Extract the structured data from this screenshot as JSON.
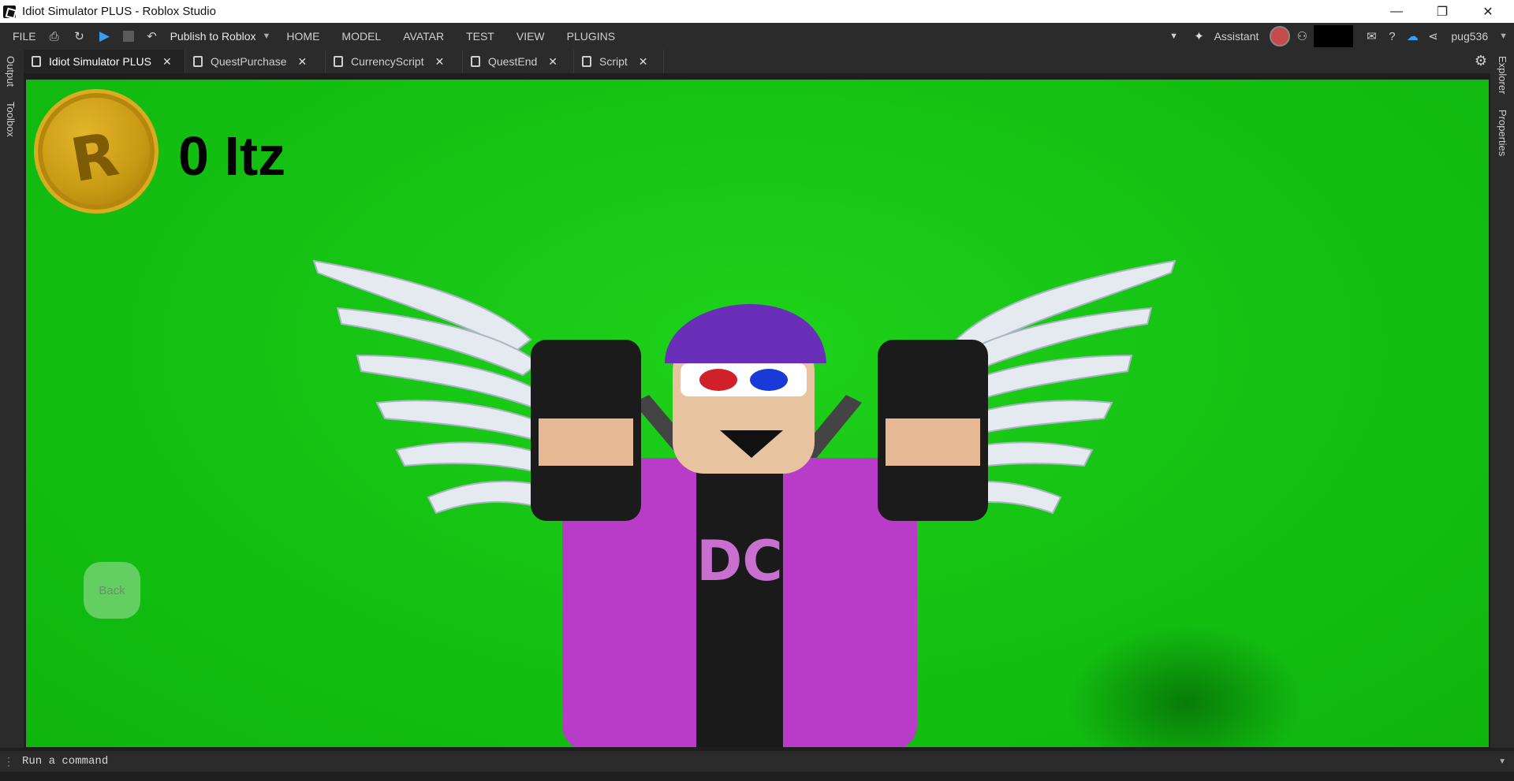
{
  "window": {
    "title": "Idiot Simulator PLUS - Roblox Studio",
    "controls": [
      "—",
      "❐",
      "✕"
    ]
  },
  "menubar": {
    "file": "FILE",
    "publish": "Publish to Roblox",
    "menus": [
      "HOME",
      "MODEL",
      "AVATAR",
      "TEST",
      "VIEW",
      "PLUGINS"
    ],
    "assistant": "Assistant",
    "username": "pug536"
  },
  "tabs": [
    {
      "label": "Idiot Simulator PLUS",
      "active": true
    },
    {
      "label": "QuestPurchase",
      "active": false
    },
    {
      "label": "CurrencyScript",
      "active": false
    },
    {
      "label": "QuestEnd",
      "active": false
    },
    {
      "label": "Script",
      "active": false
    }
  ],
  "left_rail": {
    "output": "Output",
    "toolbox": "Toolbox"
  },
  "right_rail": {
    "explorer": "Explorer",
    "properties": "Properties"
  },
  "viewport": {
    "currency_amount": "0 Itz",
    "coin_letter": "R",
    "back_button": "Back"
  },
  "command_bar": {
    "placeholder": "Run a command"
  },
  "colors": {
    "viewport_green": "#14c012",
    "play_blue": "#3a9cf0",
    "coin_gold": "#c99a14"
  }
}
